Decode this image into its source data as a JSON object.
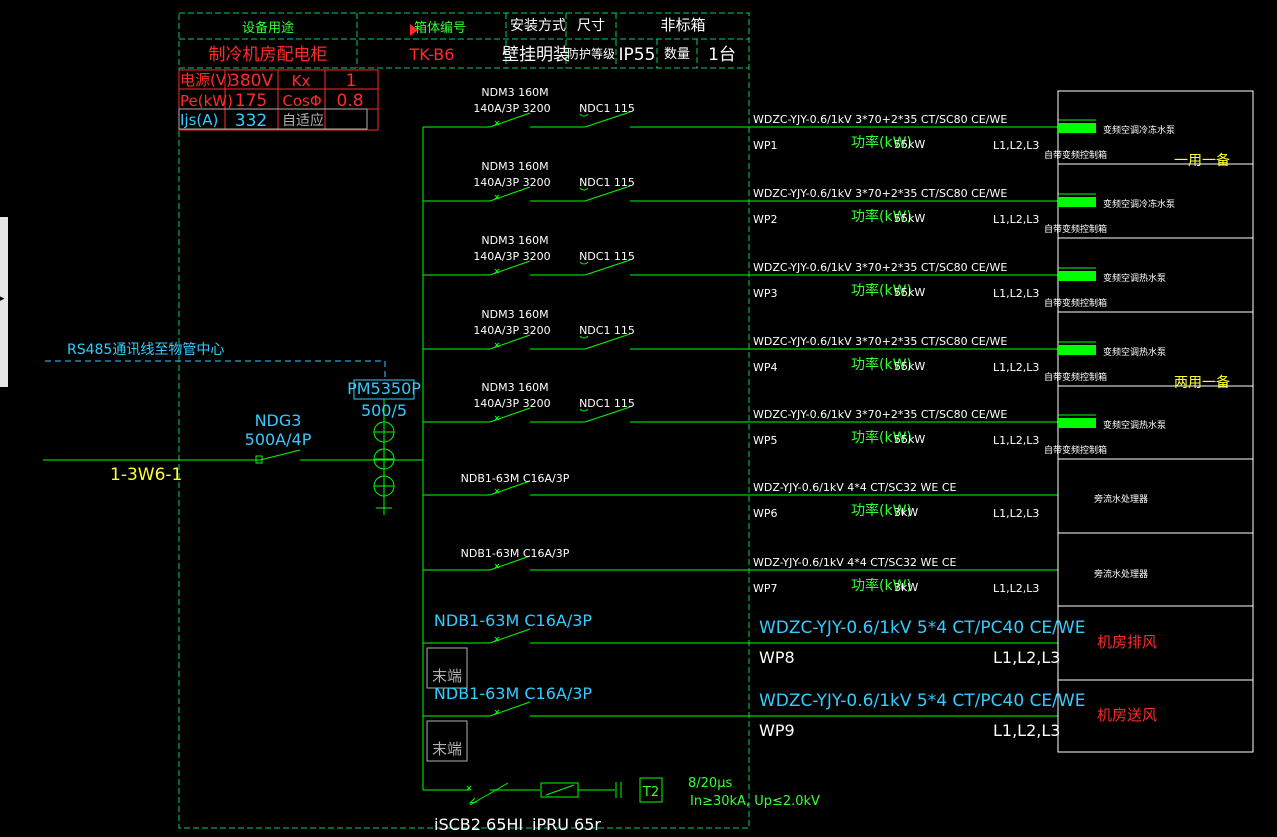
{
  "colors": {
    "bg": "#000000",
    "line": "#00ff00",
    "dash": "#00cc66",
    "green_text": "#33ff33",
    "white": "#ffffff",
    "red": "#ff2a2a",
    "cyan": "#33ccff",
    "yellow": "#ffff33",
    "grey": "#b0b0b0",
    "device_fill": "#00ff00"
  },
  "header": {
    "col1_label": "设备用途",
    "col1_value": "制冷机房配电柜",
    "col2_label": "箱体编号",
    "col2_value": "TK-B6",
    "col3_label": "安装方式",
    "col3_value": "壁挂明装",
    "col4_label": "尺寸",
    "col4_value": "防护等级",
    "col5_label": "非标箱",
    "ip": "IP55",
    "qty_label": "数量",
    "qty_value": "1台"
  },
  "params": {
    "voltage_label": "电源(V)",
    "voltage": "380V",
    "kx_label": "Kx",
    "kx": "1",
    "pe_label": "Pe(kW)",
    "pe": "175",
    "cos_label": "CosΦ",
    "cos": "0.8",
    "ijs_label": "Ijs(A)",
    "ijs": "332",
    "auto_label": "自适应"
  },
  "incoming": {
    "rs485": "RS485通讯线至物管中心",
    "main_breaker": "NDG3",
    "main_rating": "500A/4P",
    "source": "1-3W6-1",
    "meter": "PM5350P",
    "ct": "500/5"
  },
  "circuits": [
    {
      "breaker": "NDM3 160M",
      "breaker2": "140A/3P 3200",
      "contactor": "NDC1 115",
      "cable": "WDZC-YJY-0.6/1kV 3*70+2*35 CT/SC80 CE/WE",
      "id": "WP1",
      "power_label": "功率(kW)",
      "power": "55kW",
      "phase": "L1,L2,L3",
      "load": "变频空调冷冻水泵",
      "ctrl": "自带变频控制箱",
      "note": "一用一备"
    },
    {
      "breaker": "NDM3 160M",
      "breaker2": "140A/3P 3200",
      "contactor": "NDC1 115",
      "cable": "WDZC-YJY-0.6/1kV 3*70+2*35 CT/SC80 CE/WE",
      "id": "WP2",
      "power_label": "功率(kW)",
      "power": "55kW",
      "phase": "L1,L2,L3",
      "load": "变频空调冷冻水泵",
      "ctrl": "自带变频控制箱",
      "note": ""
    },
    {
      "breaker": "NDM3 160M",
      "breaker2": "140A/3P 3200",
      "contactor": "NDC1 115",
      "cable": "WDZC-YJY-0.6/1kV 3*70+2*35 CT/SC80 CE/WE",
      "id": "WP3",
      "power_label": "功率(kW)",
      "power": "55kW",
      "phase": "L1,L2,L3",
      "load": "变频空调热水泵",
      "ctrl": "自带变频控制箱",
      "note": ""
    },
    {
      "breaker": "NDM3 160M",
      "breaker2": "140A/3P 3200",
      "contactor": "NDC1 115",
      "cable": "WDZC-YJY-0.6/1kV 3*70+2*35 CT/SC80 CE/WE",
      "id": "WP4",
      "power_label": "功率(kW)",
      "power": "55kW",
      "phase": "L1,L2,L3",
      "load": "变频空调热水泵",
      "ctrl": "自带变频控制箱",
      "note": "两用一备"
    },
    {
      "breaker": "NDM3 160M",
      "breaker2": "140A/3P 3200",
      "contactor": "NDC1 115",
      "cable": "WDZC-YJY-0.6/1kV 3*70+2*35 CT/SC80 CE/WE",
      "id": "WP5",
      "power_label": "功率(kW)",
      "power": "55kW",
      "phase": "L1,L2,L3",
      "load": "变频空调热水泵",
      "ctrl": "自带变频控制箱",
      "note": ""
    },
    {
      "breaker": "NDB1-63M C16A/3P",
      "cable": "WDZ-YJY-0.6/1kV 4*4 CT/SC32 WE CE",
      "id": "WP6",
      "power_label": "功率(kW)",
      "power": "3kW",
      "phase": "L1,L2,L3",
      "load": "旁流水处理器"
    },
    {
      "breaker": "NDB1-63M C16A/3P",
      "cable": "WDZ-YJY-0.6/1kV 4*4 CT/SC32 WE CE",
      "id": "WP7",
      "power_label": "功率(kW)",
      "power": "3kW",
      "phase": "L1,L2,L3",
      "load": "旁流水处理器"
    },
    {
      "breaker": "NDB1-63M C16A/3P",
      "cable": "WDZC-YJY-0.6/1kV 5*4 CT/PC40 CE/WE",
      "id": "WP8",
      "phase": "L1,L2,L3",
      "load": "机房排风",
      "terminal": "末端"
    },
    {
      "breaker": "NDB1-63M C16A/3P",
      "cable": "WDZC-YJY-0.6/1kV 5*4 CT/PC40 CE/WE",
      "id": "WP9",
      "phase": "L1,L2,L3",
      "load": "机房送风",
      "terminal": "末端"
    }
  ],
  "spd": {
    "breaker": "iSCB2 65HI",
    "spd": "iPRU 65r",
    "t2": "T2",
    "wave": "8/20μs",
    "spec": "In≥30kA, Up≤2.0kV"
  },
  "sidebar_glyph": "▸"
}
